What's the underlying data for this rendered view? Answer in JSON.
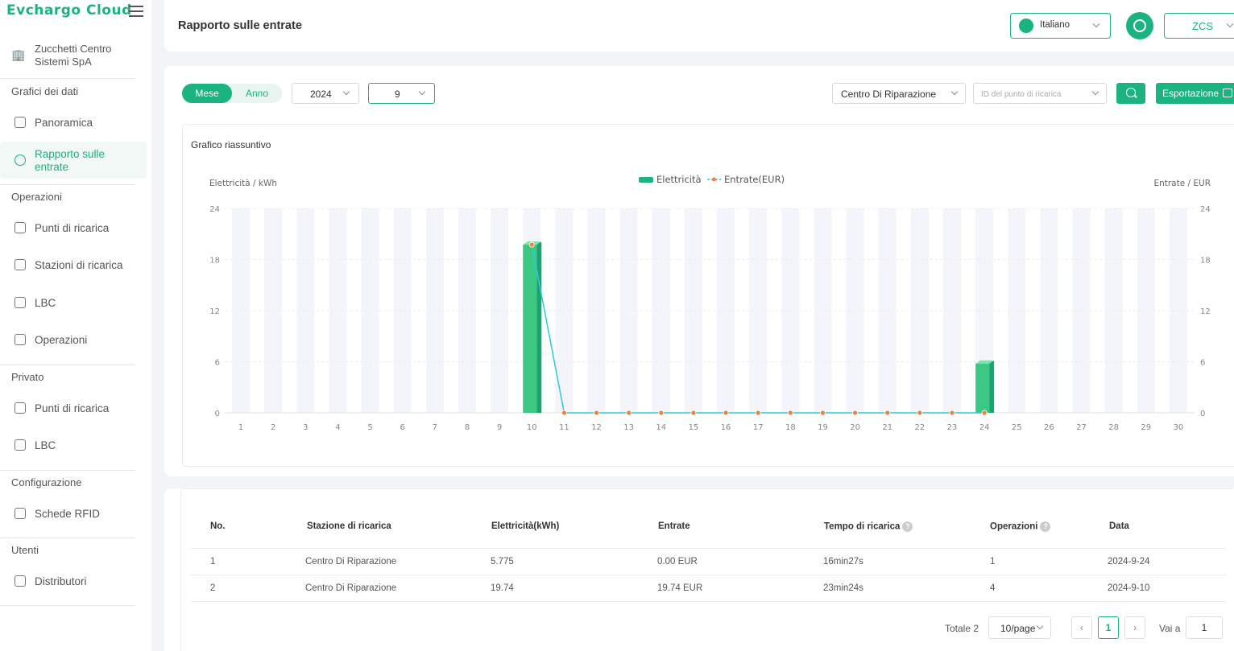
{
  "app": {
    "logo": "Evchargo Cloud"
  },
  "sidebar": {
    "company": "Zucchetti Centro Sistemi SpA",
    "sections": [
      {
        "title": "Grafici dei dati",
        "items": [
          {
            "label": "Panoramica",
            "icon": "overview-icon"
          },
          {
            "label": "Rapporto sulle entrate",
            "icon": "revenue-icon",
            "active": true
          }
        ]
      },
      {
        "title": "Operazioni",
        "items": [
          {
            "label": "Punti di ricarica",
            "icon": "charger-icon"
          },
          {
            "label": "Stazioni di ricarica",
            "icon": "home-icon"
          },
          {
            "label": "LBC",
            "icon": "lbc-icon"
          },
          {
            "label": "Operazioni",
            "icon": "operations-icon"
          }
        ]
      },
      {
        "title": "Privato",
        "items": [
          {
            "label": "Punti di ricarica",
            "icon": "charger-icon"
          },
          {
            "label": "LBC",
            "icon": "lbc-icon"
          }
        ]
      },
      {
        "title": "Configurazione",
        "items": [
          {
            "label": "Schede RFID",
            "icon": "card-icon"
          }
        ]
      },
      {
        "title": "Utenti",
        "items": [
          {
            "label": "Distributori",
            "icon": "org-icon"
          }
        ]
      }
    ]
  },
  "header": {
    "title": "Rapporto sulle entrate",
    "language": "Italiano",
    "user": "ZCS"
  },
  "filters": {
    "toggle_month": "Mese",
    "toggle_year": "Anno",
    "year": "2024",
    "month": "9",
    "station": "Centro Di Riparazione",
    "charger_placeholder": "ID del punto di ricarica",
    "export_label": "Esportazione"
  },
  "chart": {
    "title": "Grafico riassuntivo",
    "left_axis_label": "Elettricità / kWh",
    "right_axis_label": "Entrate / EUR",
    "legend_bar": "Elettricità",
    "legend_line": "Entrate(EUR)",
    "bar_color": "#1bb37f",
    "line_color": "#2dc9e0",
    "point_color": "#f0803c"
  },
  "chart_data": {
    "type": "bar",
    "title": "Grafico riassuntivo",
    "ylabel": "Elettricità / kWh",
    "y2label": "Entrate / EUR",
    "ylim": [
      0,
      24
    ],
    "y2lim": [
      0,
      24
    ],
    "yticks": [
      0,
      6,
      12,
      18,
      24
    ],
    "categories": [
      "1",
      "2",
      "3",
      "4",
      "5",
      "6",
      "7",
      "8",
      "9",
      "10",
      "11",
      "12",
      "13",
      "14",
      "15",
      "16",
      "17",
      "18",
      "19",
      "20",
      "21",
      "22",
      "23",
      "24",
      "25",
      "26",
      "27",
      "28",
      "29",
      "30"
    ],
    "series": [
      {
        "name": "Elettricità",
        "type": "bar",
        "axis": "left",
        "values": [
          0,
          0,
          0,
          0,
          0,
          0,
          0,
          0,
          0,
          19.74,
          0,
          0,
          0,
          0,
          0,
          0,
          0,
          0,
          0,
          0,
          0,
          0,
          0,
          5.775,
          0,
          0,
          0,
          0,
          0,
          0
        ]
      },
      {
        "name": "Entrate(EUR)",
        "type": "line",
        "axis": "right",
        "start_index": 9,
        "values": [
          19.74,
          0,
          0,
          0,
          0,
          0,
          0,
          0,
          0,
          0,
          0,
          0,
          0,
          0,
          0
        ]
      }
    ],
    "legend": "top-center"
  },
  "table": {
    "headers": [
      "No.",
      "Stazione di ricarica",
      "Elettricità(kWh)",
      "Entrate",
      "Tempo di ricarica",
      "Operazioni",
      "Data"
    ],
    "rows": [
      [
        "1",
        "Centro Di Riparazione",
        "5.775",
        "0.00 EUR",
        "16min27s",
        "1",
        "2024-9-24"
      ],
      [
        "2",
        "Centro Di Riparazione",
        "19.74",
        "19.74 EUR",
        "23min24s",
        "4",
        "2024-9-10"
      ]
    ]
  },
  "pagination": {
    "total": "Totale 2",
    "page_size": "10/page",
    "current": "1",
    "goto_label": "Vai a",
    "goto_value": "1"
  }
}
